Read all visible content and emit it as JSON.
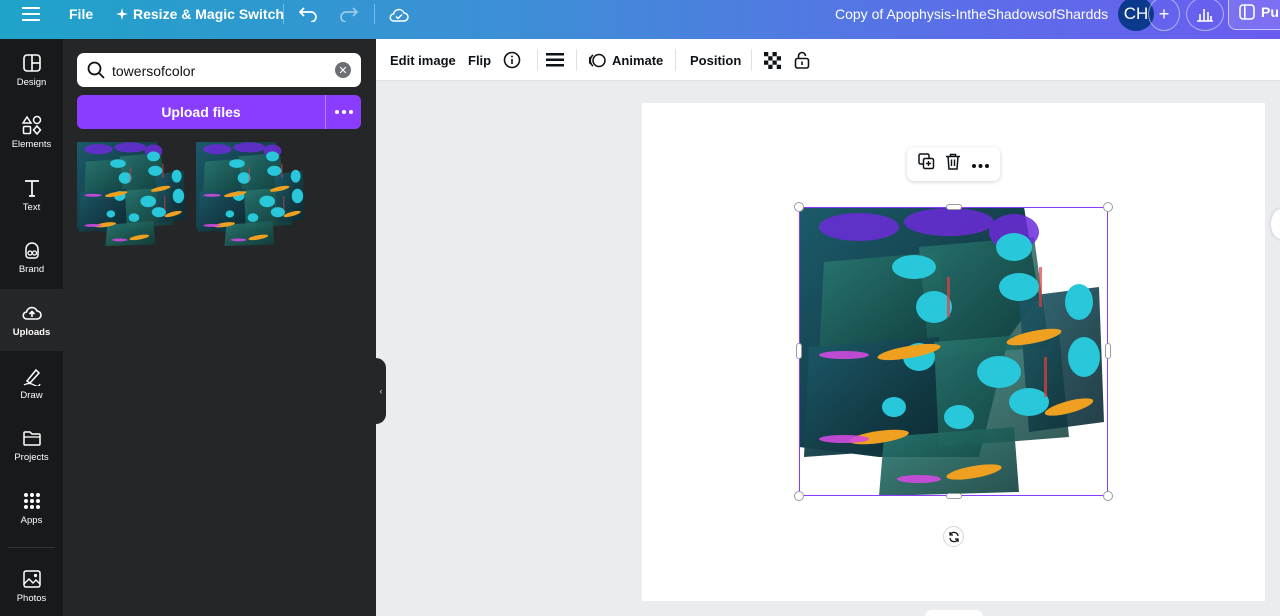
{
  "topbar": {
    "file_label": "File",
    "resize_label": "Resize & Magic Switch",
    "doc_title": "Copy of Apophysis-IntheShadowsofShardds",
    "avatar_initials": "CH",
    "publish_label": "Pu",
    "gradient_start": "#1fa3c9",
    "gradient_end": "#6a5cf0"
  },
  "rail": {
    "items": [
      {
        "label": "Design",
        "icon": "design-icon"
      },
      {
        "label": "Elements",
        "icon": "elements-icon"
      },
      {
        "label": "Text",
        "icon": "text-icon"
      },
      {
        "label": "Brand",
        "icon": "brand-icon"
      },
      {
        "label": "Uploads",
        "icon": "uploads-icon",
        "active": true
      },
      {
        "label": "Draw",
        "icon": "draw-icon"
      },
      {
        "label": "Projects",
        "icon": "folder-icon"
      },
      {
        "label": "Apps",
        "icon": "apps-icon"
      },
      {
        "label": "Photos",
        "icon": "photos-icon"
      }
    ]
  },
  "panel": {
    "search_value": "towersofcolor",
    "upload_label": "Upload files",
    "accent": "#8b3dff"
  },
  "toolbar": {
    "edit_image": "Edit image",
    "flip": "Flip",
    "animate": "Animate",
    "position": "Position"
  }
}
